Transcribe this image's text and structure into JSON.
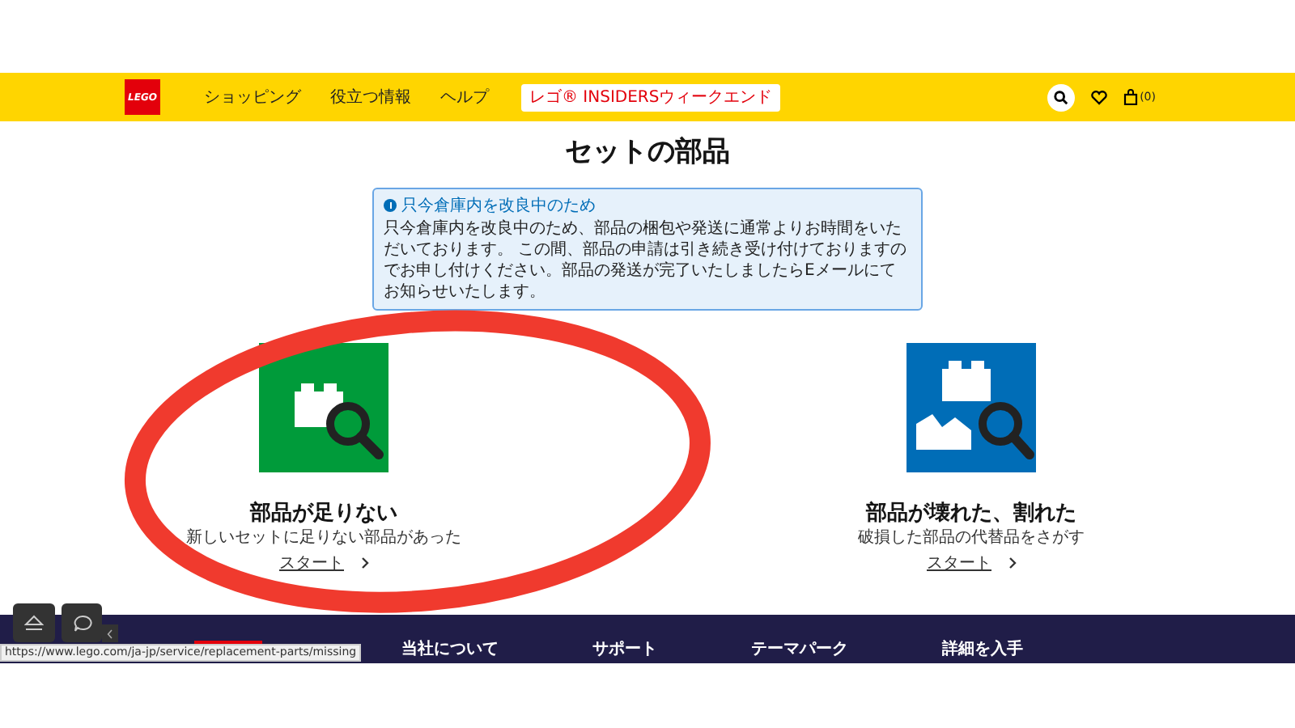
{
  "header": {
    "logo": "LEGO",
    "nav": [
      "ショッピング",
      "役立つ情報",
      "ヘルプ"
    ],
    "promo": "レゴ® INSIDERSウィークエンド",
    "cart_count": "(0)"
  },
  "title": "セットの部品",
  "notice": {
    "heading": "只今倉庫内を改良中のため",
    "body": "只今倉庫内を改良中のため、部品の梱包や発送に通常よりお時間をいただいております。 この間、部品の申請は引き続き受け付けておりますのでお申し付けください。部品の発送が完了いたしましたらEメールにてお知らせいたします。"
  },
  "options": [
    {
      "kind": "missing",
      "title": "部品が足りない",
      "subtitle": "新しいセットに足りない部品があった",
      "link": "スタート"
    },
    {
      "kind": "broken",
      "title": "部品が壊れた、割れた",
      "subtitle": "破損した部品の代替品をさがす",
      "link": "スタート"
    }
  ],
  "footer": [
    "当社について",
    "サポート",
    "テーマパーク",
    "詳細を入手"
  ],
  "status_url": "https://www.lego.com/ja-jp/service/replacement-parts/missing"
}
